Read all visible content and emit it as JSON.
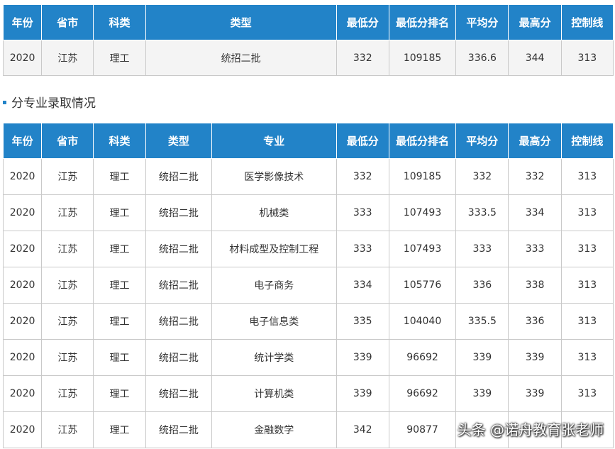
{
  "summary_table": {
    "headers": [
      "年份",
      "省市",
      "科类",
      "类型",
      "最低分",
      "最低分排名",
      "平均分",
      "最高分",
      "控制线"
    ],
    "row": [
      "2020",
      "江苏",
      "理工",
      "统招二批",
      "332",
      "109185",
      "336.6",
      "344",
      "313"
    ]
  },
  "section_title": "分专业录取情况",
  "major_table": {
    "headers": [
      "年份",
      "省市",
      "科类",
      "类型",
      "专业",
      "最低分",
      "最低分排名",
      "平均分",
      "最高分",
      "控制线"
    ],
    "rows": [
      [
        "2020",
        "江苏",
        "理工",
        "统招二批",
        "医学影像技术",
        "332",
        "109185",
        "332",
        "332",
        "313"
      ],
      [
        "2020",
        "江苏",
        "理工",
        "统招二批",
        "机械类",
        "333",
        "107493",
        "333.5",
        "334",
        "313"
      ],
      [
        "2020",
        "江苏",
        "理工",
        "统招二批",
        "材料成型及控制工程",
        "333",
        "107493",
        "333",
        "333",
        "313"
      ],
      [
        "2020",
        "江苏",
        "理工",
        "统招二批",
        "电子商务",
        "334",
        "105776",
        "336",
        "338",
        "313"
      ],
      [
        "2020",
        "江苏",
        "理工",
        "统招二批",
        "电子信息类",
        "335",
        "104040",
        "335.5",
        "336",
        "313"
      ],
      [
        "2020",
        "江苏",
        "理工",
        "统招二批",
        "统计学类",
        "339",
        "96692",
        "339",
        "339",
        "313"
      ],
      [
        "2020",
        "江苏",
        "理工",
        "统招二批",
        "计算机类",
        "339",
        "96692",
        "339",
        "339",
        "313"
      ],
      [
        "2020",
        "江苏",
        "理工",
        "统招二批",
        "金融数学",
        "342",
        "90877",
        "",
        "",
        ""
      ]
    ]
  },
  "watermark": "头条 @诺舟教育张老师",
  "colors": {
    "header_bg": "#2283c8",
    "header_text": "#ffffff",
    "border": "#c9c9c9"
  }
}
